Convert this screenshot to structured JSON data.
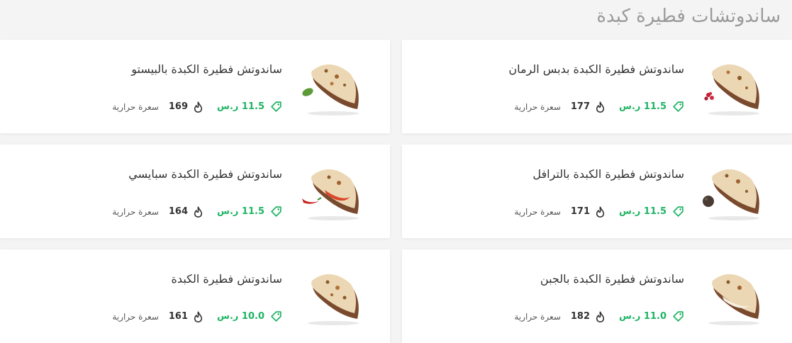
{
  "section": {
    "title": "ساندوتشات فطيرة كبدة"
  },
  "items": [
    {
      "name": "ساندوتش فطيرة الكبدة بالبيستو",
      "price": "11.5 ر.س",
      "calories": "169",
      "calories_label": "سعرة حرارية",
      "image": "liver-pie-sandwich-pesto",
      "garnish": "basil-leaf"
    },
    {
      "name": "ساندوتش فطيرة الكبدة بدبس الرمان",
      "price": "11.5 ر.س",
      "calories": "177",
      "calories_label": "سعرة حرارية",
      "image": "liver-pie-sandwich-pomegranate",
      "garnish": "pomegranate-seeds"
    },
    {
      "name": "ساندوتش فطيرة الكبدة سبايسي",
      "price": "11.5 ر.س",
      "calories": "164",
      "calories_label": "سعرة حرارية",
      "image": "liver-pie-sandwich-spicy",
      "garnish": "red-chili"
    },
    {
      "name": "ساندوتش فطيرة الكبدة بالترافل",
      "price": "11.5 ر.س",
      "calories": "171",
      "calories_label": "سعرة حرارية",
      "image": "liver-pie-sandwich-truffle",
      "garnish": "truffle"
    },
    {
      "name": "ساندوتش فطيرة الكبدة",
      "price": "10.0 ر.س",
      "calories": "161",
      "calories_label": "سعرة حرارية",
      "image": "liver-pie-sandwich",
      "garnish": ""
    },
    {
      "name": "ساندوتش فطيرة الكبدة بالجبن",
      "price": "11.0 ر.س",
      "calories": "182",
      "calories_label": "سعرة حرارية",
      "image": "liver-pie-sandwich-cheese",
      "garnish": ""
    }
  ],
  "colors": {
    "price": "#1fb464",
    "title": "#9a9a9a",
    "text": "#333333",
    "background": "#f4f4f4",
    "card": "#ffffff"
  }
}
